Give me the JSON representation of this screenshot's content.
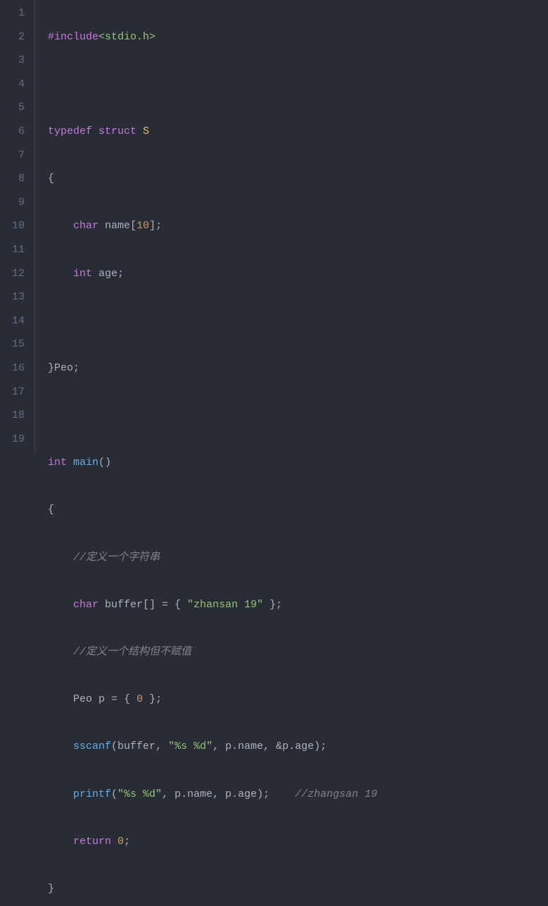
{
  "lineNumbers": [
    "1",
    "2",
    "3",
    "4",
    "5",
    "6",
    "7",
    "8",
    "9",
    "10",
    "11",
    "12",
    "13",
    "14",
    "15",
    "16",
    "17",
    "18",
    "19"
  ],
  "code": {
    "l1": {
      "pp": "#include",
      "inc": "<stdio.h>"
    },
    "l3": {
      "kw1": "typedef",
      "kw2": "struct",
      "name": "S"
    },
    "l4": {
      "brace": "{"
    },
    "l5": {
      "type": "char",
      "ident": "name",
      "lb": "[",
      "size": "10",
      "rb": "];"
    },
    "l6": {
      "type": "int",
      "ident": "age",
      "semi": ";"
    },
    "l8": {
      "rb": "}",
      "alias": "Peo",
      "semi": ";"
    },
    "l10": {
      "type": "int",
      "fn": "main",
      "parens": "()"
    },
    "l11": {
      "brace": "{"
    },
    "l12": {
      "comment": "//定义一个字符串"
    },
    "l13": {
      "type": "char",
      "ident": "buffer",
      "br": "[]",
      "eq": " = { ",
      "str": "\"zhansan 19\"",
      "close": " };"
    },
    "l14": {
      "comment": "//定义一个结构但不赋值"
    },
    "l15": {
      "type": "Peo",
      "ident": "p",
      "eq": " = { ",
      "zero": "0",
      "close": " };"
    },
    "l16": {
      "fn": "sscanf",
      "open": "(",
      "a1": "buffer",
      "c1": ", ",
      "fmt": "\"%s %d\"",
      "c2": ", ",
      "a3a": "p",
      "a3b": ".",
      "a3c": "name",
      "c3": ", ",
      "amp": "&",
      "a4a": "p",
      "a4b": ".",
      "a4c": "age",
      "close": ");"
    },
    "l17": {
      "fn": "printf",
      "open": "(",
      "fmt": "\"%s %d\"",
      "c1": ", ",
      "a2a": "p",
      "a2b": ".",
      "a2c": "name",
      "c2": ", ",
      "a3a": "p",
      "a3b": ".",
      "a3c": "age",
      "close": ");",
      "trail": "    ",
      "comment": "//zhangsan 19"
    },
    "l18": {
      "kw": "return",
      "sp": " ",
      "val": "0",
      "semi": ";"
    },
    "l19": {
      "brace": "}"
    }
  }
}
